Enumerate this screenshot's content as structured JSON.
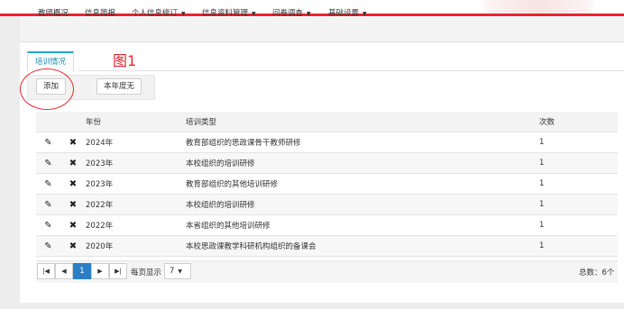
{
  "menu": {
    "items": [
      {
        "label": "教师概况",
        "dropdown": false
      },
      {
        "label": "信息简报",
        "dropdown": false
      },
      {
        "label": "个人信息修订",
        "dropdown": true
      },
      {
        "label": "信息资料管理",
        "dropdown": true
      },
      {
        "label": "问卷调查",
        "dropdown": true
      },
      {
        "label": "基础设置",
        "dropdown": true
      }
    ],
    "caret": "▼"
  },
  "tab": {
    "label": "培训情况"
  },
  "annotation": {
    "label": "图1",
    "color": "#e8252b"
  },
  "toolbar": {
    "add_label": "添加",
    "year_label": "本年度无"
  },
  "table": {
    "headers": [
      "",
      "",
      "年份",
      "培训类型",
      "次数"
    ],
    "rows": [
      {
        "year": "2024年",
        "type": "教育部组织的思政课骨干教师研修",
        "count": "1"
      },
      {
        "year": "2023年",
        "type": "本校组织的培训研修",
        "count": "1"
      },
      {
        "year": "2023年",
        "type": "教育部组织的其他培训研修",
        "count": "1"
      },
      {
        "year": "2022年",
        "type": "本校组织的培训研修",
        "count": "1"
      },
      {
        "year": "2022年",
        "type": "本省组织的其他培训研修",
        "count": "1"
      },
      {
        "year": "2020年",
        "type": "本校思政课教学科研机构组织的备课会",
        "count": "1"
      }
    ],
    "edit_icon": "pencil-icon",
    "delete_icon": "close-icon"
  },
  "pagination": {
    "first": "|◀",
    "prev": "◀",
    "current": "1",
    "next": "▶",
    "last": "▶|",
    "per_page_label": "每页显示",
    "per_page_value": "7",
    "total": "总数：6个"
  },
  "colors": {
    "accent": "#e8252b",
    "tab": "#1ea9c9",
    "active_page": "#2a7fc4"
  }
}
